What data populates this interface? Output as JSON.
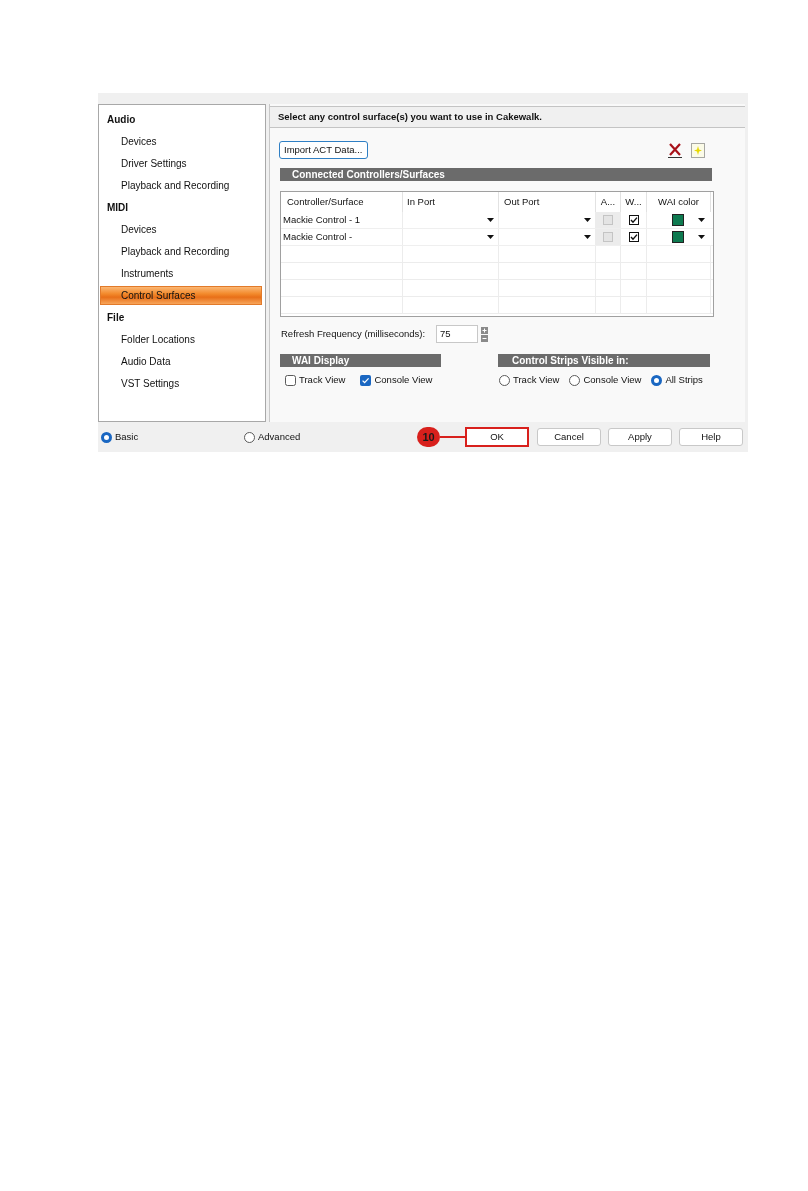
{
  "sidebar": {
    "groups": [
      {
        "heading": "Audio",
        "items": [
          {
            "label": "Devices",
            "selected": false
          },
          {
            "label": "Driver Settings",
            "selected": false
          },
          {
            "label": "Playback and Recording",
            "selected": false
          }
        ]
      },
      {
        "heading": "MIDI",
        "items": [
          {
            "label": "Devices",
            "selected": false
          },
          {
            "label": "Playback and Recording",
            "selected": false
          },
          {
            "label": "Instruments",
            "selected": false
          },
          {
            "label": "Control Surfaces",
            "selected": true
          }
        ]
      },
      {
        "heading": "File",
        "items": [
          {
            "label": "Folder Locations",
            "selected": false
          },
          {
            "label": "Audio Data",
            "selected": false
          },
          {
            "label": "VST Settings",
            "selected": false
          }
        ]
      }
    ]
  },
  "panel": {
    "header": "Select any control surface(s) you want to use in Cakewalk.",
    "import_button": "Import ACT Data...",
    "controllers": {
      "title": "Connected Controllers/Surfaces",
      "columns": [
        "Controller/Surface",
        "In Port",
        "Out Port",
        "A...",
        "W...",
        "WAI color"
      ],
      "rows": [
        {
          "name": "Mackie Control - 1",
          "a_checked": false,
          "a_disabled": true,
          "w_checked": true,
          "color": "#0e7a50"
        },
        {
          "name": "Mackie Control -",
          "a_checked": false,
          "a_disabled": true,
          "w_checked": true,
          "color": "#0e7a50"
        }
      ]
    },
    "refresh": {
      "label": "Refresh Frequency (milliseconds):",
      "value": "75"
    },
    "wai_display": {
      "title": "WAI Display",
      "options": [
        {
          "label": "Track View",
          "checked": false
        },
        {
          "label": "Console View",
          "checked": true
        }
      ]
    },
    "strips_visible": {
      "title": "Control Strips Visible in:",
      "options": [
        {
          "label": "Track View",
          "selected": false
        },
        {
          "label": "Console View",
          "selected": false
        },
        {
          "label": "All Strips",
          "selected": true
        }
      ]
    }
  },
  "footer": {
    "modes": [
      {
        "label": "Basic",
        "selected": true
      },
      {
        "label": "Advanced",
        "selected": false
      }
    ],
    "buttons": [
      {
        "label": "OK",
        "highlighted": true
      },
      {
        "label": "Cancel",
        "highlighted": false
      },
      {
        "label": "Apply",
        "highlighted": false
      },
      {
        "label": "Help",
        "highlighted": false
      }
    ]
  },
  "callout": {
    "label": "10"
  }
}
